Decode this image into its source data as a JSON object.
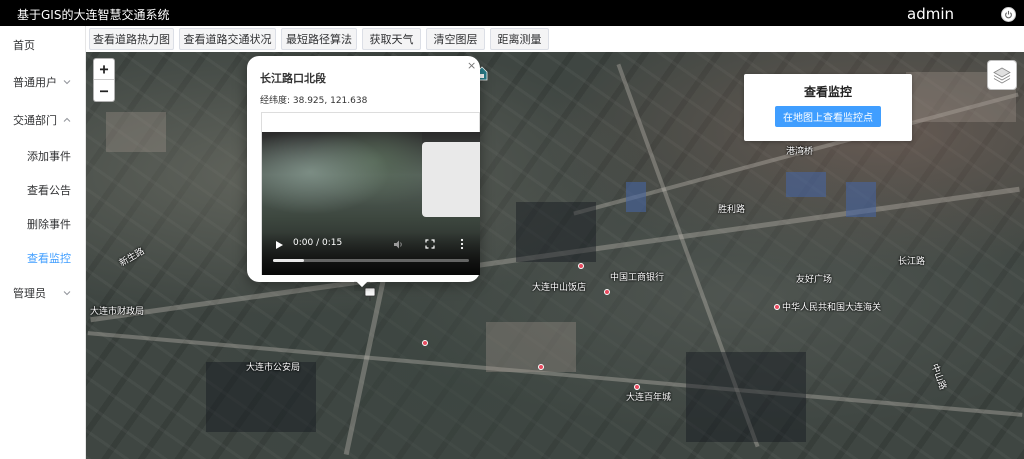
{
  "header": {
    "title": "基于GIS的大连智慧交通系统",
    "user": "admin"
  },
  "sidebar": {
    "items": [
      {
        "label": "首页"
      },
      {
        "label": "普通用户"
      },
      {
        "label": "交通部门"
      },
      {
        "label": "添加事件"
      },
      {
        "label": "查看公告"
      },
      {
        "label": "删除事件"
      },
      {
        "label": "查看监控"
      },
      {
        "label": "管理员"
      }
    ]
  },
  "toolbar": {
    "buttons": [
      {
        "label": "查看道路热力图"
      },
      {
        "label": "查看道路交通状况"
      },
      {
        "label": "最短路径算法"
      },
      {
        "label": "获取天气"
      },
      {
        "label": "清空图层"
      },
      {
        "label": "距离测量"
      }
    ]
  },
  "map": {
    "zoom_in": "+",
    "zoom_out": "−",
    "labels": [
      {
        "text": "长江路"
      },
      {
        "text": "大连市财政局"
      },
      {
        "text": "中华人民共和国大连海关"
      },
      {
        "text": "大连中山饭店"
      },
      {
        "text": "中国工商银行"
      },
      {
        "text": "胜利路"
      },
      {
        "text": "港湾桥"
      },
      {
        "text": "友好广场"
      },
      {
        "text": "大连百年城"
      },
      {
        "text": "大连市公安局"
      },
      {
        "text": "新生路"
      },
      {
        "text": "中山路"
      }
    ]
  },
  "popup": {
    "title": "长江路口北段",
    "coord": "经纬度: 38.925, 121.638",
    "close": "×",
    "video_time": "0:00 / 0:15",
    "video_progress": 0.0
  },
  "monitor": {
    "title": "查看监控",
    "button": "在地图上查看监控点"
  },
  "colors": {
    "accent": "#409eff",
    "header_bg": "#000000"
  }
}
